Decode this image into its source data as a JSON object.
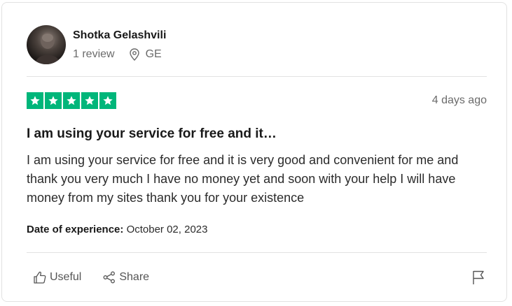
{
  "reviewer": {
    "name": "Shotka Gelashvili",
    "reviews": "1 review",
    "country": "GE"
  },
  "review": {
    "rating": 5,
    "rating_max": 5,
    "star_color": "#00b67a",
    "date_ago": "4 days ago",
    "title": "I am using your service for free and it…",
    "body": "I am using your service for free and it is very good and convenient for me and thank you very much I have no money yet and soon with your help I will have money from my sites thank you for your existence",
    "experience_label": "Date of experience:",
    "experience_date": "October 02, 2023"
  },
  "actions": {
    "useful_label": "Useful",
    "share_label": "Share"
  },
  "icons": {
    "location": "location-pin-icon",
    "useful": "thumbs-up-icon",
    "share": "share-icon",
    "flag": "flag-icon",
    "star": "star-icon"
  }
}
